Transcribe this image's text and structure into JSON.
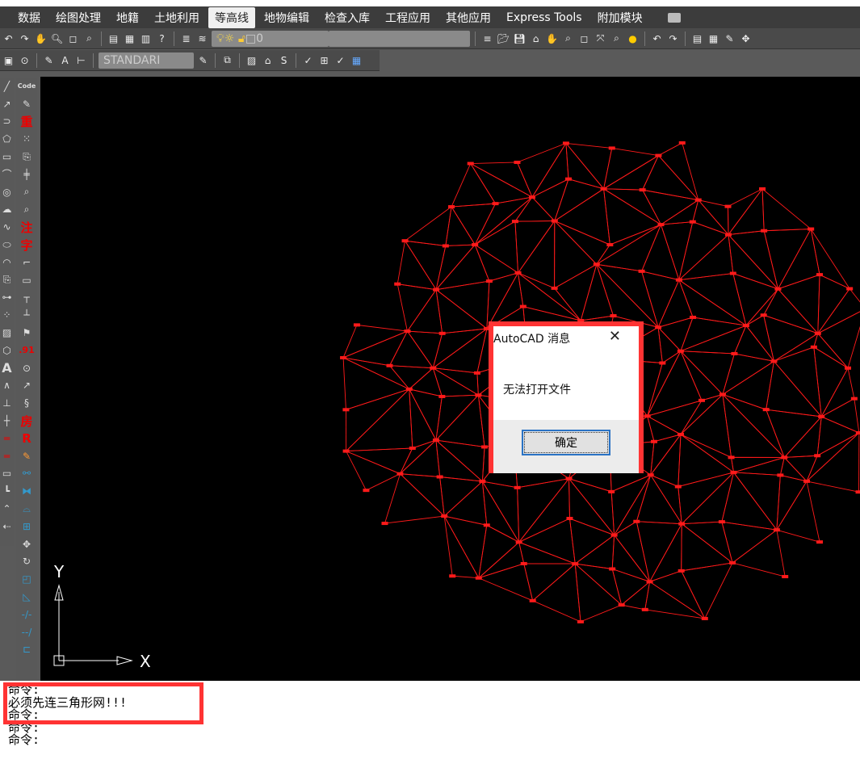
{
  "menubar": {
    "items": [
      "数据",
      "绘图处理",
      "地籍",
      "土地利用",
      "等高线",
      "地物编辑",
      "检查入库",
      "工程应用",
      "其他应用",
      "Express Tools",
      "附加模块"
    ],
    "active": "等高线"
  },
  "toolbar": {
    "layer_value": "0",
    "textstyle_value": "STANDARI"
  },
  "left_toolbar": {
    "labels": [
      "Code",
      "重",
      "注",
      "字",
      ".91",
      "房",
      "R"
    ]
  },
  "ucs": {
    "x_label": "X",
    "y_label": "Y"
  },
  "dialog": {
    "title": "AutoCAD 消息",
    "close": "✕",
    "message": "无法打开文件",
    "ok_label": "确定"
  },
  "command_line": {
    "lines": [
      "命令:",
      "必须先连三角形网!!!",
      "命令:",
      "命令:",
      "命令:"
    ]
  },
  "colors": {
    "mesh": "#ff1a1a",
    "highlight": "#ff3333",
    "canvas": "#000000"
  }
}
